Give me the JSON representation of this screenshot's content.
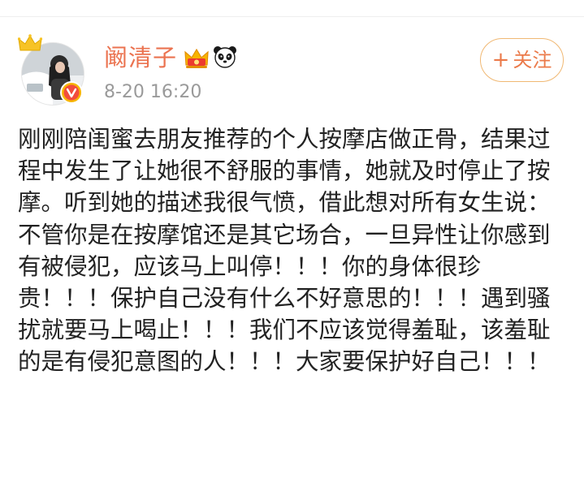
{
  "author": {
    "name": "阚清子",
    "timestamp": "8-20 16:20",
    "avatar_icon": "user-avatar",
    "badges": [
      "crown-icon",
      "verified-v-icon",
      "vip-crown-icon",
      "panda-icon"
    ]
  },
  "follow": {
    "plus": "+",
    "label": "关注"
  },
  "post": {
    "text": "刚刚陪闺蜜去朋友推荐的个人按摩店做正骨，结果过程中发生了让她很不舒服的事情，她就及时停止了按摩。听到她的描述我很气愤，借此想对所有女生说：\n不管你是在按摩馆还是其它场合，一旦异性让你感到有被侵犯，应该马上叫停！！！你的身体很珍贵！！！保护自己没有什么不好意思的！！！遇到骚扰就要马上喝止！！！我们不应该觉得羞耻，该羞耻的是有侵犯意图的人！！！大家要保护好自己！！！"
  },
  "colors": {
    "username": "#eb7350",
    "timestamp": "#9a9a9a",
    "follow_border": "#f0b873",
    "follow_text": "#eb7a4a",
    "body_text": "#222222"
  }
}
